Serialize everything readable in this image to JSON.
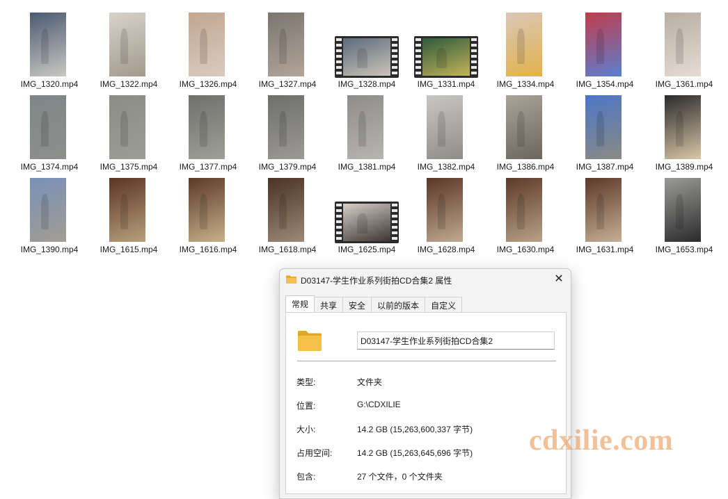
{
  "files": [
    {
      "name": "IMG_1320.mp4",
      "thumb": "portrait",
      "colors": [
        "#4b5a72",
        "#c9c7c2"
      ]
    },
    {
      "name": "IMG_1322.mp4",
      "thumb": "portrait",
      "colors": [
        "#d6d3cc",
        "#a39a8c"
      ]
    },
    {
      "name": "IMG_1326.mp4",
      "thumb": "portrait",
      "colors": [
        "#c2a690",
        "#d9cbbf"
      ]
    },
    {
      "name": "IMG_1327.mp4",
      "thumb": "portrait",
      "colors": [
        "#7a7670",
        "#b2a499"
      ]
    },
    {
      "name": "IMG_1328.mp4",
      "thumb": "video",
      "colors": [
        "#5c6a7c",
        "#cbc4b8"
      ]
    },
    {
      "name": "IMG_1331.mp4",
      "thumb": "video",
      "colors": [
        "#2f5a3c",
        "#c2b35a"
      ]
    },
    {
      "name": "IMG_1334.mp4",
      "thumb": "portrait",
      "colors": [
        "#d9c7b8",
        "#e3b24a"
      ]
    },
    {
      "name": "IMG_1354.mp4",
      "thumb": "portrait",
      "colors": [
        "#c23b4a",
        "#5a7fd0"
      ]
    },
    {
      "name": "IMG_1361.mp4",
      "thumb": "portrait",
      "colors": [
        "#b9aea4",
        "#e4dcd3"
      ]
    },
    {
      "name": "IMG_1374.mp4",
      "thumb": "portrait",
      "colors": [
        "#7f8686",
        "#8d8f8c"
      ]
    },
    {
      "name": "IMG_1375.mp4",
      "thumb": "portrait",
      "colors": [
        "#8a8c86",
        "#9c9d97"
      ]
    },
    {
      "name": "IMG_1377.mp4",
      "thumb": "portrait",
      "colors": [
        "#6f706c",
        "#a09f99"
      ]
    },
    {
      "name": "IMG_1379.mp4",
      "thumb": "portrait",
      "colors": [
        "#6e6e6a",
        "#9c9a96"
      ]
    },
    {
      "name": "IMG_1381.mp4",
      "thumb": "portrait",
      "colors": [
        "#8e8d8b",
        "#b6b5b2"
      ]
    },
    {
      "name": "IMG_1382.mp4",
      "thumb": "portrait",
      "colors": [
        "#c8c7c4",
        "#8f8d89"
      ]
    },
    {
      "name": "IMG_1386.mp4",
      "thumb": "portrait",
      "colors": [
        "#a9a398",
        "#6c675e"
      ]
    },
    {
      "name": "IMG_1387.mp4",
      "thumb": "portrait",
      "colors": [
        "#4b76c6",
        "#8a8a84"
      ]
    },
    {
      "name": "IMG_1389.mp4",
      "thumb": "portrait",
      "colors": [
        "#2a2a2c",
        "#d8c6a6"
      ]
    },
    {
      "name": "IMG_1390.mp4",
      "thumb": "portrait",
      "colors": [
        "#7891b8",
        "#a39c92"
      ]
    },
    {
      "name": "IMG_1615.mp4",
      "thumb": "portrait",
      "colors": [
        "#5a3424",
        "#b7a07c"
      ]
    },
    {
      "name": "IMG_1616.mp4",
      "thumb": "portrait",
      "colors": [
        "#5b3a28",
        "#c6b08a"
      ]
    },
    {
      "name": "IMG_1618.mp4",
      "thumb": "portrait",
      "colors": [
        "#4c3224",
        "#9a8a76"
      ]
    },
    {
      "name": "IMG_1625.mp4",
      "thumb": "video",
      "colors": [
        "#d6cfc7",
        "#3b3634"
      ]
    },
    {
      "name": "IMG_1628.mp4",
      "thumb": "portrait",
      "colors": [
        "#5a3626",
        "#bfa991"
      ]
    },
    {
      "name": "IMG_1630.mp4",
      "thumb": "portrait",
      "colors": [
        "#5c3a29",
        "#b7a187"
      ]
    },
    {
      "name": "IMG_1631.mp4",
      "thumb": "portrait",
      "colors": [
        "#5b3928",
        "#c4ae96"
      ]
    },
    {
      "name": "IMG_1653.mp4",
      "thumb": "portrait",
      "colors": [
        "#9a9a98",
        "#2b2b2b"
      ]
    }
  ],
  "dialog": {
    "title": "D03147-学生作业系列街拍CD合集2 属性",
    "close_glyph": "✕",
    "tabs": [
      "常规",
      "共享",
      "安全",
      "以前的版本",
      "自定义"
    ],
    "active_tab": "常规",
    "folder_name": "D03147-学生作业系列街拍CD合集2",
    "properties": [
      {
        "key": "类型:",
        "value": "文件夹"
      },
      {
        "key": "位置:",
        "value": "G:\\CDXILIE"
      },
      {
        "key": "大小:",
        "value": "14.2 GB (15,263,600,337 字节)"
      },
      {
        "key": "占用空间:",
        "value": "14.2 GB (15,263,645,696 字节)"
      },
      {
        "key": "包含:",
        "value": "27 个文件，0 个文件夹"
      }
    ]
  },
  "colors": {
    "folder": "#f4c04a",
    "folder_dark": "#e0a52a"
  },
  "watermark": "cdxilie.com"
}
